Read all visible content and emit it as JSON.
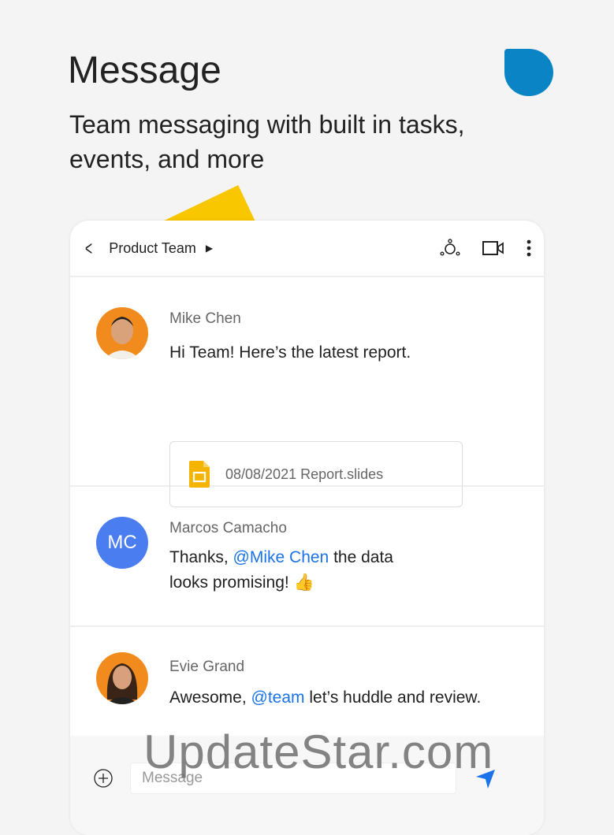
{
  "hero": {
    "title": "Message",
    "subtitle": "Team messaging with built in tasks, events, and more"
  },
  "chat": {
    "header": {
      "title": "Product Team"
    },
    "messages": [
      {
        "sender": "Mike Chen",
        "text": "Hi Team! Here’s the latest report.",
        "attachment": "08/08/2021 Report.slides"
      },
      {
        "sender": "Marcos Camacho",
        "initials": "MC",
        "pre": "Thanks, ",
        "mention": "@Mike Chen",
        "post": " the data",
        "line2": "looks promising! 👍"
      },
      {
        "sender": "Evie Grand",
        "pre": "Awesome, ",
        "mention": "@team",
        "post": " let’s huddle and review."
      }
    ],
    "compose": {
      "placeholder": "Message"
    }
  },
  "watermark": "UpdateStar.com",
  "colors": {
    "accent": "#1a73e8",
    "blob": "#0a84c4",
    "triangle": "#f9c700",
    "avatar_mc": "#4a7ef0"
  }
}
